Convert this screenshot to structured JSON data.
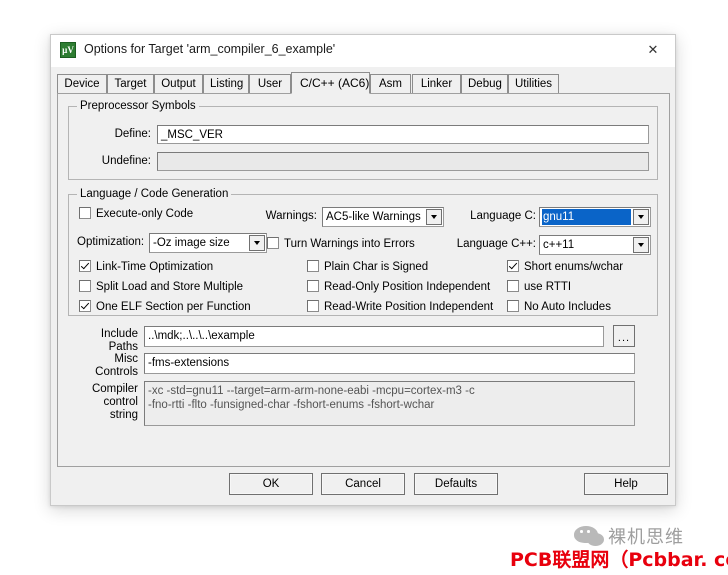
{
  "window": {
    "title": "Options for Target 'arm_compiler_6_example'",
    "icon": "uvision-icon",
    "close_label": "✕"
  },
  "tabs": [
    {
      "label": "Device",
      "active": false
    },
    {
      "label": "Target",
      "active": false
    },
    {
      "label": "Output",
      "active": false
    },
    {
      "label": "Listing",
      "active": false
    },
    {
      "label": "User",
      "active": false
    },
    {
      "label": "C/C++ (AC6)",
      "active": true
    },
    {
      "label": "Asm",
      "active": false
    },
    {
      "label": "Linker",
      "active": false
    },
    {
      "label": "Debug",
      "active": false
    },
    {
      "label": "Utilities",
      "active": false
    }
  ],
  "preprocessor": {
    "legend": "Preprocessor Symbols",
    "define_label": "Define:",
    "define_value": "_MSC_VER",
    "undefine_label": "Undefine:",
    "undefine_value": ""
  },
  "language": {
    "legend": "Language / Code Generation",
    "checks_left": [
      {
        "label": "Execute-only Code",
        "checked": false
      },
      {
        "label": "Link-Time Optimization",
        "checked": true
      },
      {
        "label": "Split Load and Store Multiple",
        "checked": false
      },
      {
        "label": "One ELF Section per Function",
        "checked": true
      }
    ],
    "optimization_label": "Optimization:",
    "optimization_value": "-Oz image size",
    "warnings_label": "Warnings:",
    "warnings_value": "AC5-like Warnings",
    "turn_warnings_label": "Turn Warnings into Errors",
    "turn_warnings_checked": false,
    "checks_mid": [
      {
        "label": "Plain Char is Signed",
        "checked": false
      },
      {
        "label": "Read-Only Position Independent",
        "checked": false
      },
      {
        "label": "Read-Write Position Independent",
        "checked": false
      }
    ],
    "language_c_label": "Language C:",
    "language_c_value": "gnu11",
    "language_c_selected": true,
    "language_cpp_label": "Language C++:",
    "language_cpp_value": "c++11",
    "checks_right": [
      {
        "label": "Short enums/wchar",
        "checked": true
      },
      {
        "label": "use RTTI",
        "checked": false
      },
      {
        "label": "No Auto Includes",
        "checked": false
      }
    ]
  },
  "fields": {
    "include_label_line1": "Include",
    "include_label_line2": "Paths",
    "include_value": "..\\mdk;..\\..\\..\\example",
    "browse_label": "...",
    "misc_label_line1": "Misc",
    "misc_label_line2": "Controls",
    "misc_value": "-fms-extensions",
    "compiler_label_line1": "Compiler",
    "compiler_label_line2": "control",
    "compiler_label_line3": "string",
    "compiler_value": "-xc -std=gnu11 --target=arm-arm-none-eabi -mcpu=cortex-m3 -c\n-fno-rtti -flto -funsigned-char -fshort-enums -fshort-wchar"
  },
  "buttons": {
    "ok": "OK",
    "cancel": "Cancel",
    "defaults": "Defaults",
    "help": "Help"
  },
  "watermark": {
    "wechat_name": "裸机思维",
    "red_text": "PCB联盟网（Pcbbar. com）"
  },
  "colors": {
    "dialog_bg": "#f0f0f0",
    "accent_select": "#0a64c8",
    "watermark_red": "#e8000d",
    "icon_green": "#2e7d32"
  }
}
